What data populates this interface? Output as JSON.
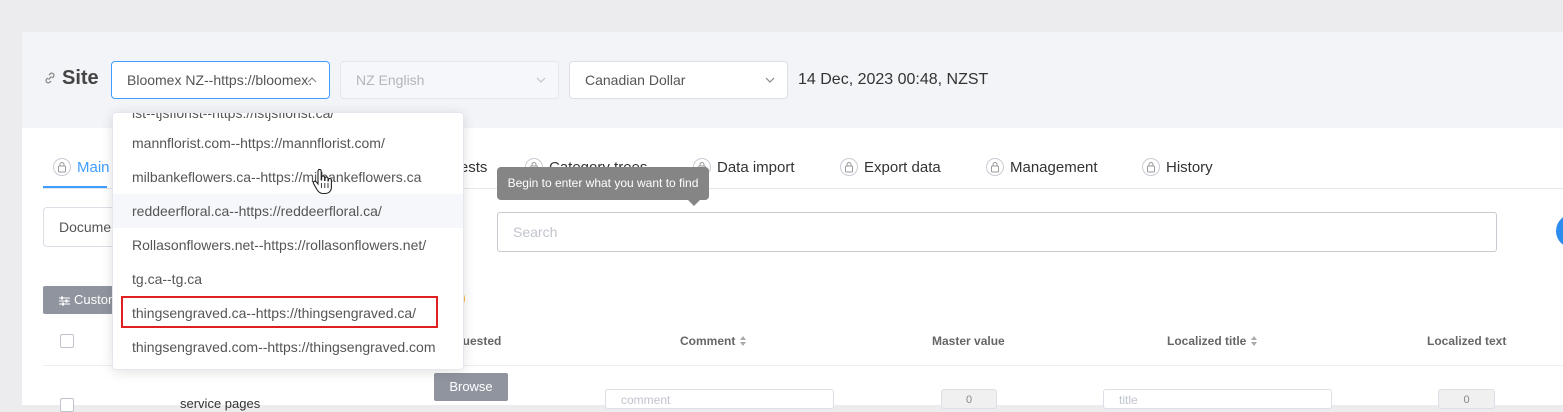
{
  "site": {
    "label": "Site",
    "site_select_value": "Bloomex NZ--https://bloomex.co.nz/",
    "language_select_value": "NZ English",
    "currency_select_value": "Canadian Dollar",
    "datetime": "14 Dec, 2023 00:48, NZST"
  },
  "tabs": [
    {
      "label": "Main"
    },
    {
      "label": "Requests"
    },
    {
      "label": "Category trees"
    },
    {
      "label": "Data import"
    },
    {
      "label": "Export data"
    },
    {
      "label": "Management"
    },
    {
      "label": "History"
    }
  ],
  "filter": {
    "type_select_value": "Document",
    "search_placeholder": "Search",
    "tooltip": "Begin to enter what you want to find"
  },
  "toolbar": {
    "customize_label": "Customize"
  },
  "table": {
    "headers": {
      "requested": "Requested",
      "comment": "Comment",
      "master_value": "Master value",
      "localized_title": "Localized title",
      "localized_text": "Localized text"
    },
    "first_row": {
      "name": "service pages",
      "browse_label": "Browse",
      "comment_placeholder": "comment",
      "master_chip": "0",
      "title_placeholder": "title",
      "text_chip": "0"
    }
  },
  "dropdown": {
    "items": [
      {
        "label": "lst--tjsflorist--https://lstjsflorist.ca/"
      },
      {
        "label": "mannflorist.com--https://mannflorist.com/"
      },
      {
        "label": "milbankeflowers.ca--https://milbankeflowers.ca"
      },
      {
        "label": "reddeerfloral.ca--https://reddeerfloral.ca/"
      },
      {
        "label": "Rollasonflowers.net--https://rollasonflowers.net/"
      },
      {
        "label": "tg.ca--tg.ca"
      },
      {
        "label": "thingsengraved.ca--https://thingsengraved.ca/"
      },
      {
        "label": "thingsengraved.com--https://thingsengraved.com"
      }
    ],
    "hovered_index": 3,
    "highlighted_index": 6
  },
  "colors": {
    "accent": "#409eff",
    "highlight_box": "#e02020",
    "tooltip_bg": "#858585"
  }
}
